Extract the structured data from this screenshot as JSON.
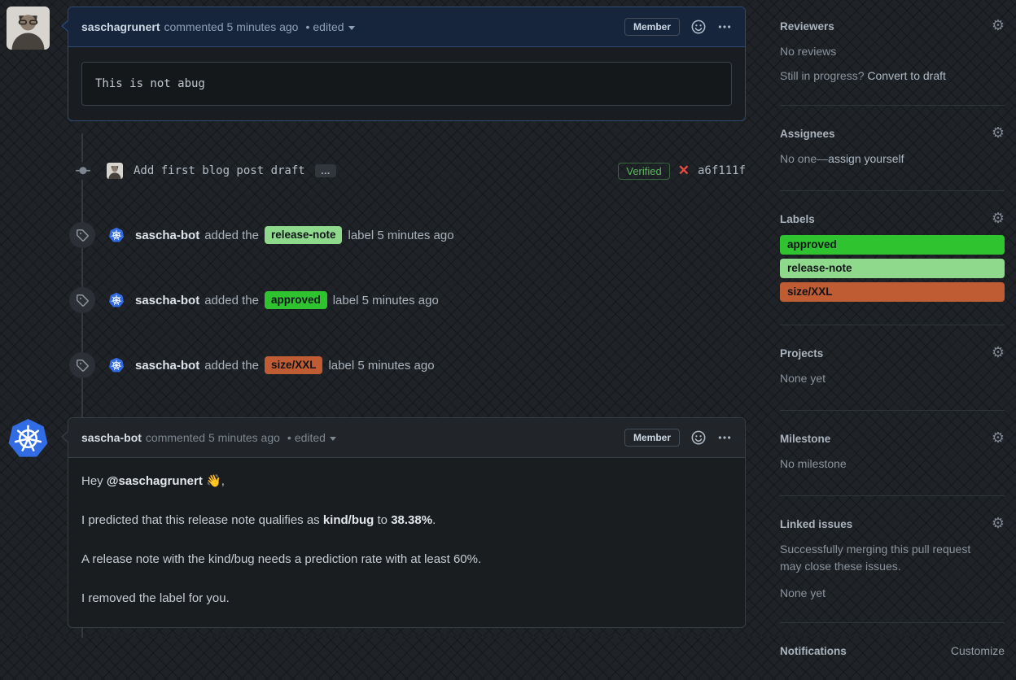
{
  "comment1": {
    "author": "saschagrunert",
    "meta": "commented 5 minutes ago",
    "bullet": "•",
    "edited": "edited",
    "member_badge": "Member",
    "code": "This is not abug"
  },
  "commit": {
    "message": "Add first blog post draft",
    "ellipsis": "…",
    "verified_badge": "Verified",
    "x_mark": "✕",
    "hash": "a6f111f"
  },
  "events": [
    {
      "actor": "sascha-bot",
      "action": "added the",
      "label": "release-note",
      "label_bg": "#8fd98c",
      "suffix": "label 5 minutes ago"
    },
    {
      "actor": "sascha-bot",
      "action": "added the",
      "label": "approved",
      "label_bg": "#2fc42f",
      "suffix": "label 5 minutes ago"
    },
    {
      "actor": "sascha-bot",
      "action": "added the",
      "label": "size/XXL",
      "label_bg": "#c05c33",
      "suffix": "label 5 minutes ago"
    }
  ],
  "comment2": {
    "author": "sascha-bot",
    "meta": "commented 5 minutes ago",
    "bullet": "•",
    "edited": "edited",
    "member_badge": "Member",
    "p1_prefix": "Hey ",
    "p1_mention": "@saschagrunert",
    "p1_suffix": " 👋,",
    "p2_1": "I predicted that this release note qualifies as ",
    "p2_bold1": "kind/bug",
    "p2_2": " to ",
    "p2_bold2": "38.38%",
    "p2_3": ".",
    "p3": "A release note with the kind/bug needs a prediction rate with at least 60%.",
    "p4": "I removed the label for you."
  },
  "sidebar": {
    "reviewers": {
      "title": "Reviewers",
      "empty": "No reviews",
      "hint_prefix": "Still in progress? ",
      "hint_link": "Convert to draft"
    },
    "assignees": {
      "title": "Assignees",
      "empty_prefix": "No one—",
      "empty_link": "assign yourself"
    },
    "labels": {
      "title": "Labels",
      "items": [
        {
          "name": "approved",
          "bg": "#2fc42f"
        },
        {
          "name": "release-note",
          "bg": "#8fd98c"
        },
        {
          "name": "size/XXL",
          "bg": "#c05c33"
        }
      ]
    },
    "projects": {
      "title": "Projects",
      "empty": "None yet"
    },
    "milestone": {
      "title": "Milestone",
      "empty": "No milestone"
    },
    "linked_issues": {
      "title": "Linked issues",
      "description": "Successfully merging this pull request may close these issues.",
      "empty": "None yet"
    },
    "notifications": {
      "title": "Notifications",
      "customize": "Customize"
    }
  },
  "icons": {
    "gear": "gear-icon ⚙",
    "tag": "tag-icon",
    "git_commit": "git-commit-icon",
    "smiley": "smiley-icon",
    "kebab": "kebab-horizontal-icon",
    "kubernetes_logo_color": "#326ce5",
    "verified_color": "#5cba5f",
    "x_mark_color": "#eb4b46"
  }
}
